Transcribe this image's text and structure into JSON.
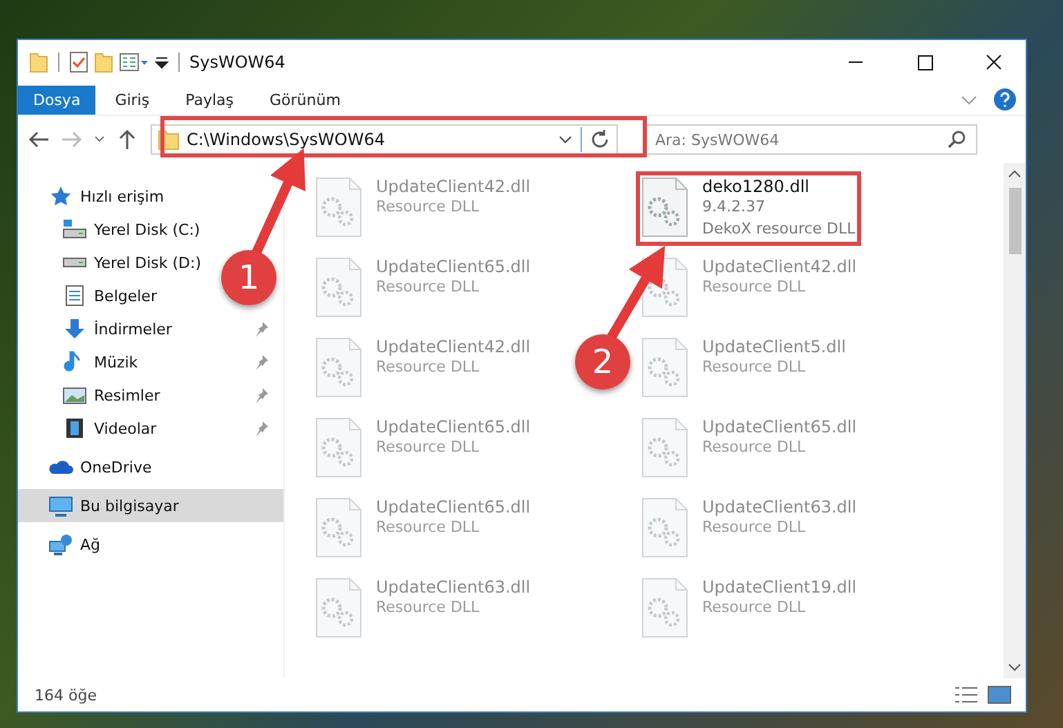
{
  "window": {
    "title": "SysWOW64"
  },
  "ribbon_tabs": [
    {
      "label": "Dosya",
      "selected": true
    },
    {
      "label": "Giriş",
      "selected": false
    },
    {
      "label": "Paylaş",
      "selected": false
    },
    {
      "label": "Görünüm",
      "selected": false
    }
  ],
  "address": {
    "path": "C:\\Windows\\SysWOW64"
  },
  "search": {
    "placeholder": "Ara: SysWOW64"
  },
  "sidebar": {
    "items": [
      {
        "label": "Hızlı erişim",
        "kind": "star",
        "selected": false,
        "children": [
          {
            "label": "Yerel Disk (C:)",
            "kind": "drive-c",
            "pinned": false
          },
          {
            "label": "Yerel Disk (D:)",
            "kind": "drive",
            "pinned": false
          },
          {
            "label": "Belgeler",
            "kind": "docs",
            "pinned": false
          },
          {
            "label": "İndirmeler",
            "kind": "download",
            "pinned": true
          },
          {
            "label": "Müzik",
            "kind": "music",
            "pinned": true
          },
          {
            "label": "Resimler",
            "kind": "pictures",
            "pinned": true
          },
          {
            "label": "Videolar",
            "kind": "video",
            "pinned": true
          }
        ]
      },
      {
        "label": "OneDrive",
        "kind": "cloud",
        "selected": false
      },
      {
        "label": "Bu bilgisayar",
        "kind": "pc",
        "selected": true
      },
      {
        "label": "Ağ",
        "kind": "network",
        "selected": false
      }
    ]
  },
  "files": [
    {
      "name": "UpdateClient42.dll",
      "lines": [
        "Resource DLL"
      ],
      "blurred": true,
      "highlighted": false
    },
    {
      "name": "deko1280.dll",
      "lines": [
        "9.4.2.37",
        "DekoX resource DLL"
      ],
      "blurred": false,
      "highlighted": true
    },
    {
      "name": "UpdateClient65.dll",
      "lines": [
        "Resource DLL"
      ],
      "blurred": true,
      "highlighted": false
    },
    {
      "name": "UpdateClient42.dll",
      "lines": [
        "Resource DLL"
      ],
      "blurred": true,
      "highlighted": false
    },
    {
      "name": "UpdateClient42.dll",
      "lines": [
        "Resource DLL"
      ],
      "blurred": true,
      "highlighted": false
    },
    {
      "name": "UpdateClient5.dll",
      "lines": [
        "Resource DLL"
      ],
      "blurred": true,
      "highlighted": false
    },
    {
      "name": "UpdateClient65.dll",
      "lines": [
        "Resource DLL"
      ],
      "blurred": true,
      "highlighted": false
    },
    {
      "name": "UpdateClient65.dll",
      "lines": [
        "Resource DLL"
      ],
      "blurred": true,
      "highlighted": false
    },
    {
      "name": "UpdateClient65.dll",
      "lines": [
        "Resource DLL"
      ],
      "blurred": true,
      "highlighted": false
    },
    {
      "name": "UpdateClient63.dll",
      "lines": [
        "Resource DLL"
      ],
      "blurred": true,
      "highlighted": false
    },
    {
      "name": "UpdateClient63.dll",
      "lines": [
        "Resource DLL"
      ],
      "blurred": true,
      "highlighted": false
    },
    {
      "name": "UpdateClient19.dll",
      "lines": [
        "Resource DLL"
      ],
      "blurred": true,
      "highlighted": false
    }
  ],
  "status_bar": {
    "count": "164 öğe"
  },
  "annotations": [
    {
      "number": "1"
    },
    {
      "number": "2"
    }
  ]
}
